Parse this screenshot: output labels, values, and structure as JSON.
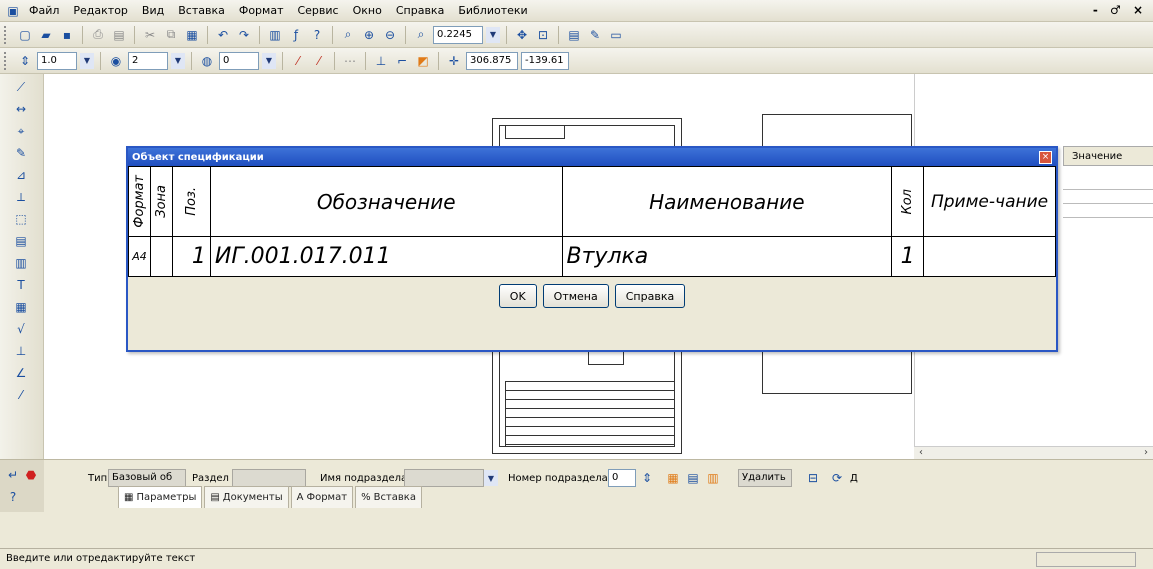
{
  "menubar": {
    "items": [
      "Файл",
      "Редактор",
      "Вид",
      "Вставка",
      "Формат",
      "Сервис",
      "Окно",
      "Справка",
      "Библиотеки"
    ],
    "window_controls": "- ♂ ×"
  },
  "toolbar1": {
    "zoom_value": "0.2245"
  },
  "toolbar2": {
    "line_width": "1.0",
    "layer": "2",
    "style": "0",
    "coord_x": "306.875",
    "coord_y": "-139.61"
  },
  "right_panel": {
    "value_header": "Значение"
  },
  "dialog": {
    "title": "Объект спецификации",
    "headers": {
      "format": "Формат",
      "zone": "Зона",
      "pos": "Поз.",
      "designation": "Обозначение",
      "name": "Наименование",
      "qty": "Кол",
      "note": "Приме-чание"
    },
    "row": {
      "format": "А4",
      "zone": "",
      "pos": "1",
      "designation": "ИГ.001.017.011",
      "name": "Втулка",
      "qty": "1",
      "note": ""
    },
    "buttons": {
      "ok": "OK",
      "cancel": "Отмена",
      "help": "Справка"
    }
  },
  "panel": {
    "type_label": "Тип",
    "type_value": "Базовый об",
    "section_label": "Раздел",
    "section_value": "",
    "subsection_label": "Имя подраздела",
    "subsection_value": "",
    "subsection_num_label": "Номер подраздела",
    "subsection_num_value": "0",
    "tabs": [
      "Параметры",
      "Документы",
      "Формат",
      "Вставка"
    ],
    "cut_label": "Удалить",
    "trailing": "Д"
  },
  "status": {
    "text": "Введите или отредактируйте текст"
  }
}
